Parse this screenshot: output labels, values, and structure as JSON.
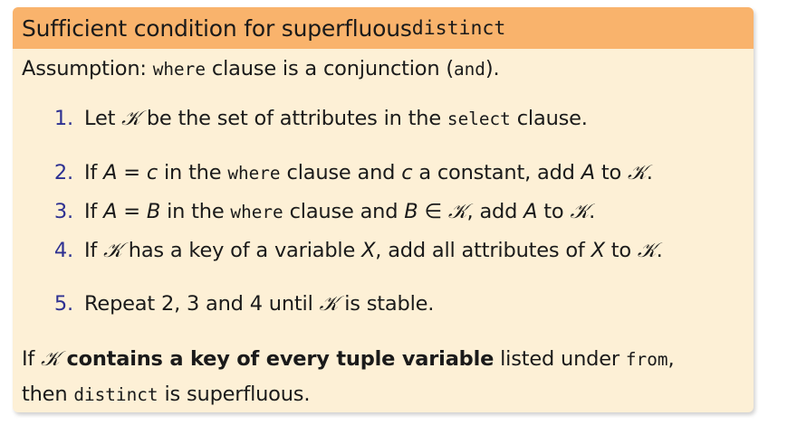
{
  "title": {
    "text": "Sufficient condition for superfluous ",
    "code": "distinct"
  },
  "assumption": {
    "lead": "Assumption: ",
    "code_where": "where",
    "mid": " clause is a conjunction (",
    "code_and": "and",
    "end": ")."
  },
  "steps": [
    {
      "num": "1.",
      "a": "Let ",
      "k": "𝒦",
      "b": " be the set of attributes in the ",
      "code": "select",
      "c": " clause."
    },
    {
      "num": "2.",
      "a": "If ",
      "v1": "A",
      "b": " = ",
      "v2": "c",
      "c": " in the ",
      "code": "where",
      "d": " clause and ",
      "v3": "c",
      "e": " a constant, add ",
      "v4": "A",
      "f": " to ",
      "k": "𝒦",
      "g": "."
    },
    {
      "num": "3.",
      "a": "If ",
      "v1": "A",
      "b": " = ",
      "v2": "B",
      "c": " in the ",
      "code": "where",
      "d": " clause and ",
      "v3": "B",
      "e": " ∈ ",
      "k1": "𝒦",
      "f": ", add ",
      "v4": "A",
      "g": " to ",
      "k2": "𝒦",
      "h": "."
    },
    {
      "num": "4.",
      "a": "If ",
      "k1": "𝒦",
      "b": " has a key of a variable ",
      "v1": "X",
      "c": ", add all attributes of ",
      "v2": "X",
      "d": " to ",
      "k2": "𝒦",
      "e": "."
    },
    {
      "num": "5.",
      "a": "Repeat 2, 3 and 4 until ",
      "k": "𝒦",
      "b": " is stable."
    }
  ],
  "conclusion": {
    "a": "If ",
    "k": "𝒦",
    "bold": " contains a key of every tuple variable",
    "b": " listed under ",
    "code_from": "from",
    "c": ",",
    "line2_a": "then ",
    "code_distinct": "distinct",
    "line2_b": " is superfluous."
  }
}
